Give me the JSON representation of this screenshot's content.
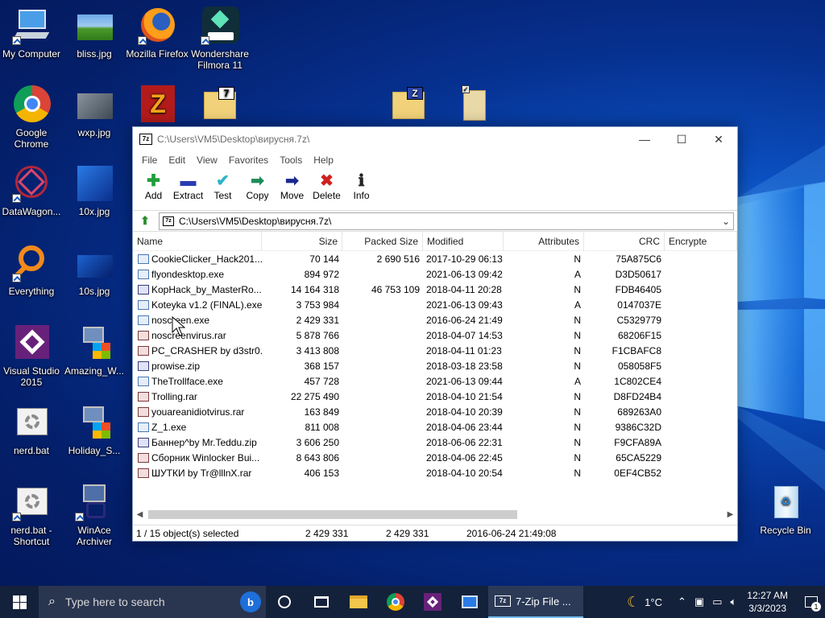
{
  "desktop": {
    "icons": [
      {
        "label": "My Computer"
      },
      {
        "label": "bliss.jpg"
      },
      {
        "label": "Mozilla Firefox"
      },
      {
        "label": "Wondershare Filmora 11"
      },
      {
        "label": "Google Chrome"
      },
      {
        "label": "wxp.jpg"
      },
      {
        "label": "DataWagon..."
      },
      {
        "label": "10x.jpg"
      },
      {
        "label": "Everything"
      },
      {
        "label": "10s.jpg"
      },
      {
        "label": "Visual Studio 2015"
      },
      {
        "label": "Amazing_W..."
      },
      {
        "label": "nerd.bat"
      },
      {
        "label": "Holiday_S..."
      },
      {
        "label": "nerd.bat - Shortcut"
      },
      {
        "label": "WinAce Archiver"
      },
      {
        "label": "Recycle Bin"
      }
    ]
  },
  "window": {
    "title": "C:\\Users\\VM5\\Desktop\\вирусня.7z\\",
    "app_icon_text": "7z",
    "controls": {
      "minimize": "—",
      "maximize": "☐",
      "close": "✕"
    },
    "menu": [
      "File",
      "Edit",
      "View",
      "Favorites",
      "Tools",
      "Help"
    ],
    "toolbar": [
      {
        "label": "Add",
        "icon": "plus-icon",
        "glyph": "✚",
        "color": "#1f9d3a"
      },
      {
        "label": "Extract",
        "icon": "minus-icon",
        "glyph": "▬",
        "color": "#2a3db0"
      },
      {
        "label": "Test",
        "icon": "check-icon",
        "glyph": "✔",
        "color": "#2fb3c7"
      },
      {
        "label": "Copy",
        "icon": "copy-arrow-icon",
        "glyph": "➡",
        "color": "#1e8c5a"
      },
      {
        "label": "Move",
        "icon": "move-arrow-icon",
        "glyph": "➡",
        "color": "#1a2a8c"
      },
      {
        "label": "Delete",
        "icon": "delete-x-icon",
        "glyph": "✖",
        "color": "#d12020"
      },
      {
        "label": "Info",
        "icon": "info-icon",
        "glyph": "ℹ",
        "color": "#222222"
      }
    ],
    "address": {
      "path": "C:\\Users\\VM5\\Desktop\\вирусня.7z\\",
      "icon_text": "7z"
    },
    "columns": {
      "name": "Name",
      "size": "Size",
      "packed": "Packed Size",
      "modified": "Modified",
      "attributes": "Attributes",
      "crc": "CRC",
      "encrypted": "Encrypte"
    },
    "files": [
      {
        "name": "CookieClicker_Hack201...",
        "size": "70 144",
        "packed": "2 690 516",
        "modified": "2017-10-29 06:13",
        "attr": "N",
        "crc": "75A875C6",
        "type": "exe"
      },
      {
        "name": "flyondesktop.exe",
        "size": "894 972",
        "packed": "",
        "modified": "2021-06-13 09:42",
        "attr": "A",
        "crc": "D3D50617",
        "type": "exe"
      },
      {
        "name": "KopHack_by_MasterRo...",
        "size": "14 164 318",
        "packed": "46 753 109",
        "modified": "2018-04-11 20:28",
        "attr": "N",
        "crc": "FDB46405",
        "type": "zip"
      },
      {
        "name": "Koteyka v1.2 (FINAL).exe",
        "size": "3 753 984",
        "packed": "",
        "modified": "2021-06-13 09:43",
        "attr": "A",
        "crc": "0147037E",
        "type": "exe"
      },
      {
        "name": "noscreen.exe",
        "size": "2 429 331",
        "packed": "",
        "modified": "2016-06-24 21:49",
        "attr": "N",
        "crc": "C5329779",
        "type": "exe"
      },
      {
        "name": "noscreenvirus.rar",
        "size": "5 878 766",
        "packed": "",
        "modified": "2018-04-07 14:53",
        "attr": "N",
        "crc": "68206F15",
        "type": "rar"
      },
      {
        "name": "PC_CRASHER by d3str0...",
        "size": "3 413 808",
        "packed": "",
        "modified": "2018-04-11 01:23",
        "attr": "N",
        "crc": "F1CBAFC8",
        "type": "rar"
      },
      {
        "name": "prowise.zip",
        "size": "368 157",
        "packed": "",
        "modified": "2018-03-18 23:58",
        "attr": "N",
        "crc": "058058F5",
        "type": "zip"
      },
      {
        "name": "TheTrollface.exe",
        "size": "457 728",
        "packed": "",
        "modified": "2021-06-13 09:44",
        "attr": "A",
        "crc": "1C802CE4",
        "type": "exe"
      },
      {
        "name": "Trolling.rar",
        "size": "22 275 490",
        "packed": "",
        "modified": "2018-04-10 21:54",
        "attr": "N",
        "crc": "D8FD24B4",
        "type": "rar"
      },
      {
        "name": "youareanidiotvirus.rar",
        "size": "163 849",
        "packed": "",
        "modified": "2018-04-10 20:39",
        "attr": "N",
        "crc": "689263A0",
        "type": "rar"
      },
      {
        "name": "Z_1.exe",
        "size": "811 008",
        "packed": "",
        "modified": "2018-04-06 23:44",
        "attr": "N",
        "crc": "9386C32D",
        "type": "exe"
      },
      {
        "name": "Баннер^by Mr.Teddu.zip",
        "size": "3 606 250",
        "packed": "",
        "modified": "2018-06-06 22:31",
        "attr": "N",
        "crc": "F9CFA89A",
        "type": "zip"
      },
      {
        "name": "Сборник Winlocker Bui...",
        "size": "8 643 806",
        "packed": "",
        "modified": "2018-04-06 22:45",
        "attr": "N",
        "crc": "65CA5229",
        "type": "rar"
      },
      {
        "name": "ШУТКИ by Tr@lllnX.rar",
        "size": "406 153",
        "packed": "",
        "modified": "2018-04-10 20:54",
        "attr": "N",
        "crc": "0EF4CB52",
        "type": "rar"
      }
    ],
    "status": {
      "selection": "1 / 15 object(s) selected",
      "size": "2 429 331",
      "packed": "2 429 331",
      "modified": "2016-06-24 21:49:08"
    }
  },
  "taskbar": {
    "search_placeholder": "Type here to search",
    "active_app": "7-Zip File ...",
    "active_app_icon": "7z",
    "weather": "1°C",
    "time": "12:27 AM",
    "date": "3/3/2023",
    "notification_count": "1"
  },
  "colors": {
    "accent": "#0a4fc0",
    "taskbar": "#14213a"
  }
}
